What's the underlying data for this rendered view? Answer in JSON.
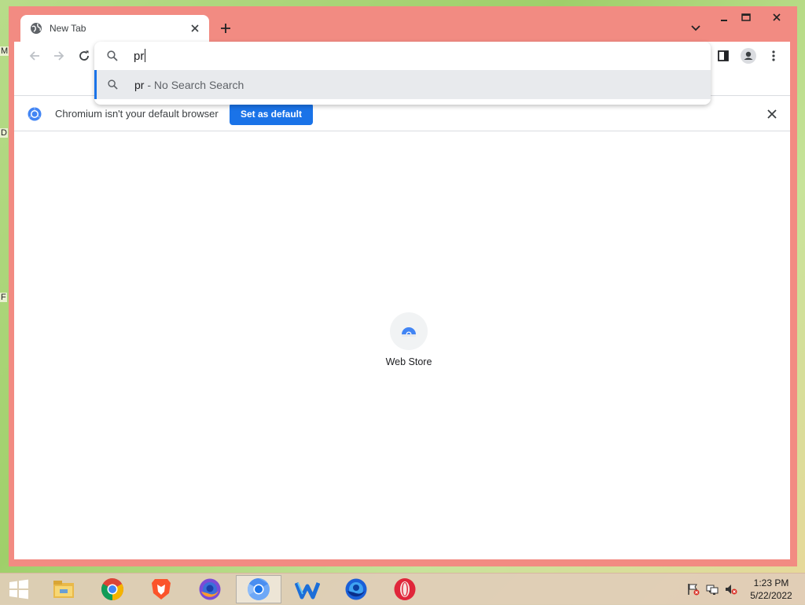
{
  "desktop": {
    "edge_labels": [
      "M",
      "D",
      "F"
    ]
  },
  "browser": {
    "colors": {
      "frame": "#f28b82",
      "accent": "#1a73e8"
    },
    "tab": {
      "title": "New Tab",
      "icon": "globe-icon"
    },
    "omnibox": {
      "value": "pr",
      "suggestion": {
        "query": "pr",
        "separator": " - ",
        "engine": "No Search Search"
      }
    },
    "infobar": {
      "message": "Chromium isn't your default browser",
      "button_label": "Set as default"
    },
    "shortcuts": [
      {
        "label": "Web Store",
        "icon": "web-store-icon"
      }
    ]
  },
  "taskbar": {
    "apps": [
      {
        "name": "start-button",
        "icon": "windows-logo-icon"
      },
      {
        "name": "file-explorer",
        "icon": "folder-icon"
      },
      {
        "name": "chrome",
        "icon": "chrome-icon"
      },
      {
        "name": "brave",
        "icon": "brave-icon"
      },
      {
        "name": "firefox",
        "icon": "firefox-icon"
      },
      {
        "name": "chromium",
        "icon": "chromium-icon",
        "active": true
      },
      {
        "name": "waterfox",
        "icon": "waterfox-icon"
      },
      {
        "name": "firefox-dev",
        "icon": "firefox-dev-icon"
      },
      {
        "name": "opera",
        "icon": "opera-icon"
      }
    ],
    "clock": {
      "time": "1:23 PM",
      "date": "5/22/2022"
    }
  }
}
